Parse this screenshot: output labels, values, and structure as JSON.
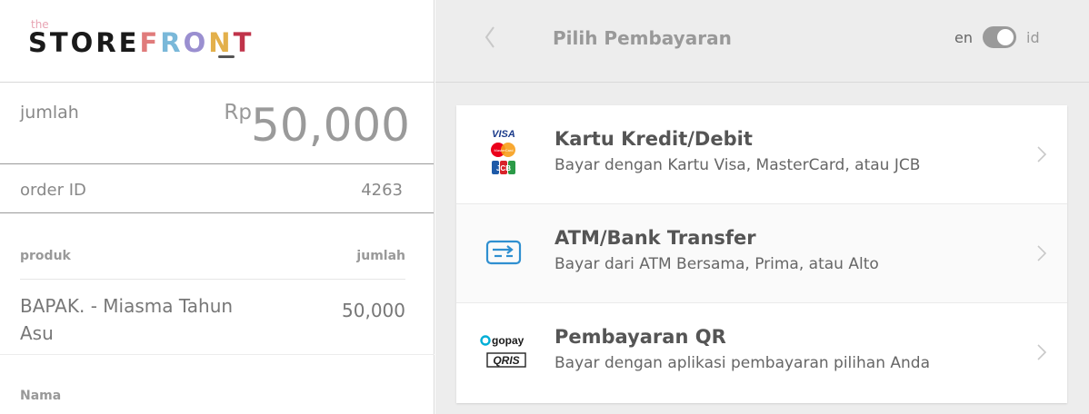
{
  "brand": {
    "the": "the",
    "letters": [
      "STORE",
      "F",
      "R",
      "O",
      "N",
      "T"
    ]
  },
  "summary": {
    "amount_label": "jumlah",
    "currency": "Rp",
    "amount": "50,000",
    "order_label": "order ID",
    "order_id": "4263"
  },
  "items_table": {
    "col_product": "produk",
    "col_amount": "jumlah",
    "rows": [
      {
        "product": "BAPAK. - Miasma Tahun Asu",
        "amount": "50,000"
      }
    ],
    "name_label": "Nama"
  },
  "header": {
    "title": "Pilih Pembayaran",
    "lang_left": "en",
    "lang_right": "id",
    "toggle_state": "id"
  },
  "methods": [
    {
      "title": "Kartu Kredit/Debit",
      "desc": "Bayar dengan Kartu Visa, MasterCard, atau JCB",
      "icon": "card-brands-icon"
    },
    {
      "title": "ATM/Bank Transfer",
      "desc": "Bayar dari ATM Bersama, Prima, atau Alto",
      "icon": "bank-transfer-icon"
    },
    {
      "title": "Pembayaran QR",
      "desc": "Bayar dengan aplikasi pembayaran pilihan Anda",
      "icon": "gopay-qris-icon"
    }
  ],
  "icon_labels": {
    "visa": "VISA",
    "mastercard": "MasterCard",
    "jcb": "JCB",
    "gopay": "gopay",
    "qris": "QRIS"
  },
  "colors": {
    "accent_blue": "#2f8fd0",
    "mastercard_red": "#eb001b",
    "mastercard_orange": "#f79e1b",
    "panel_bg": "#ededed"
  }
}
